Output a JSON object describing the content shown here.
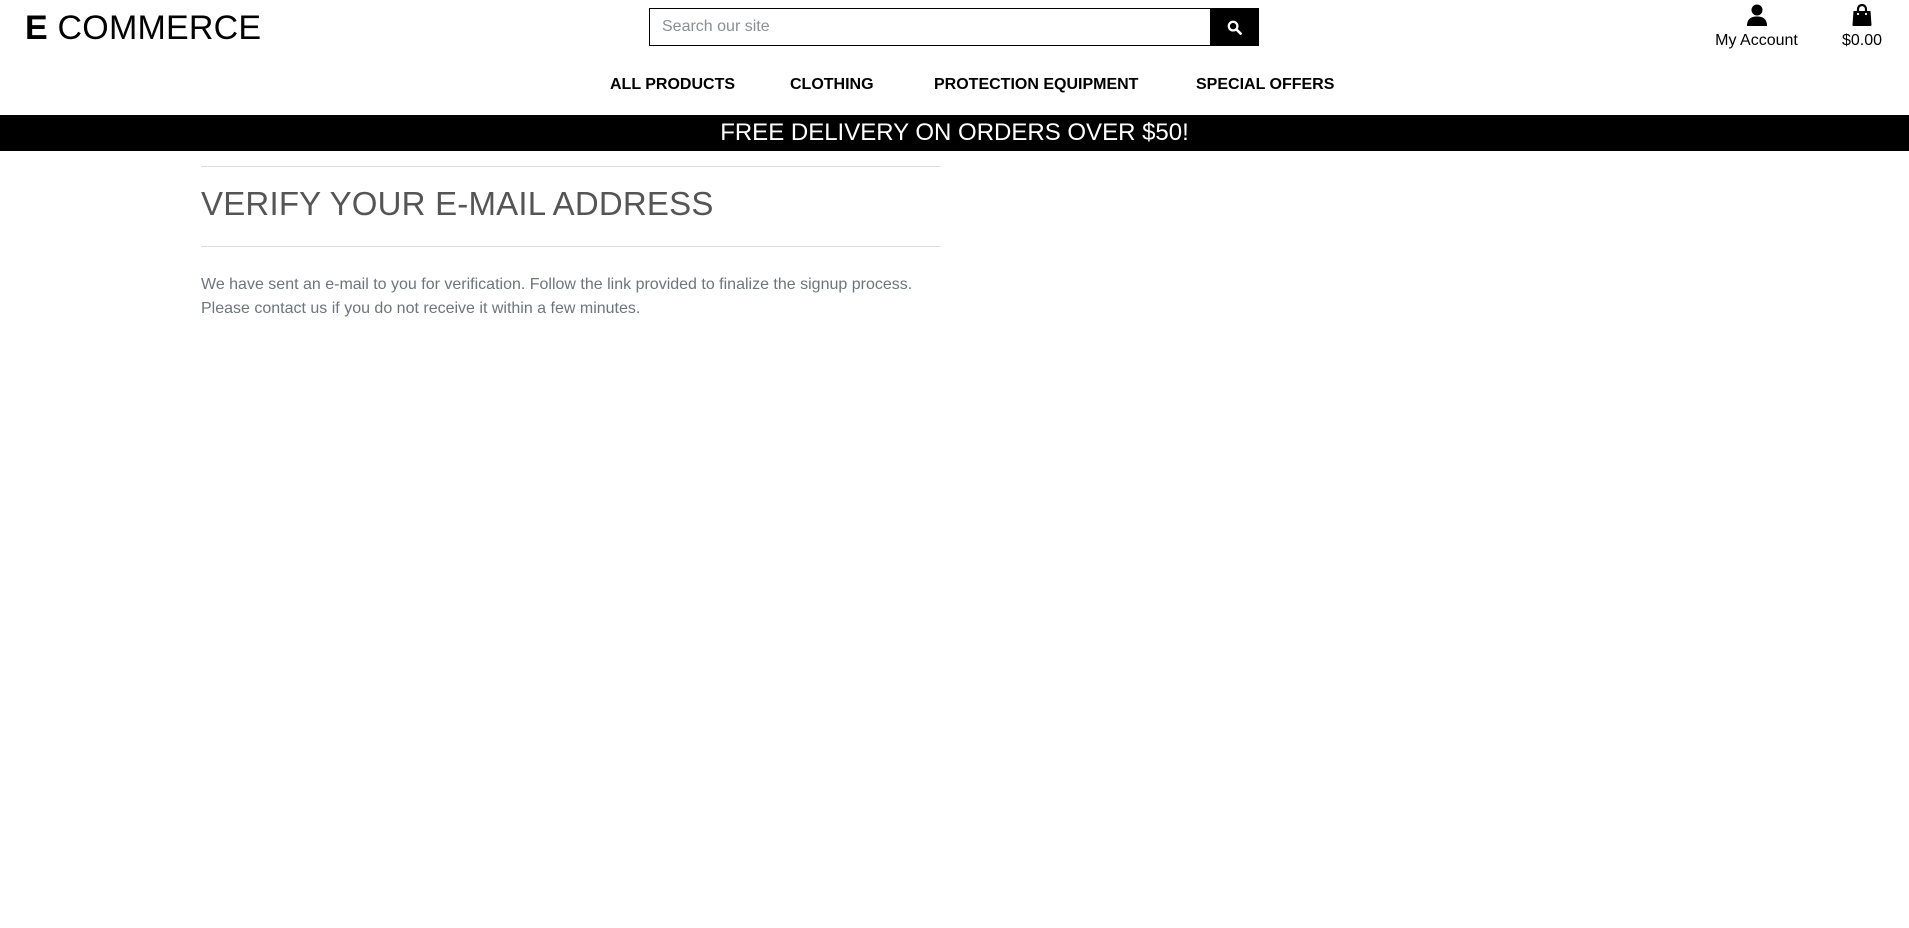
{
  "header": {
    "logo_strong": "E",
    "logo_rest": "COMMERCE",
    "search_placeholder": "Search our site",
    "search_icon": "magnifier-icon",
    "account_label": "My Account",
    "account_icon": "user-icon",
    "cart_total": "$0.00",
    "cart_icon": "shopping-bag-icon"
  },
  "nav": {
    "items": [
      {
        "label": "ALL PRODUCTS"
      },
      {
        "label": "CLOTHING"
      },
      {
        "label": "PROTECTION EQUIPMENT"
      },
      {
        "label": "SPECIAL OFFERS"
      }
    ]
  },
  "banner": {
    "text": "FREE DELIVERY ON ORDERS OVER $50!"
  },
  "main": {
    "title": "VERIFY YOUR E-MAIL ADDRESS",
    "message_line1": "We have sent an e-mail to you for verification. Follow the link provided to finalize the signup process.",
    "message_line2": "Please contact us if you do not receive it within a few minutes."
  },
  "colors": {
    "banner_bg": "#000000",
    "banner_text": "#ffffff",
    "title_text": "#555555",
    "body_text": "#6c757d",
    "rule": "#dcdcdc"
  }
}
